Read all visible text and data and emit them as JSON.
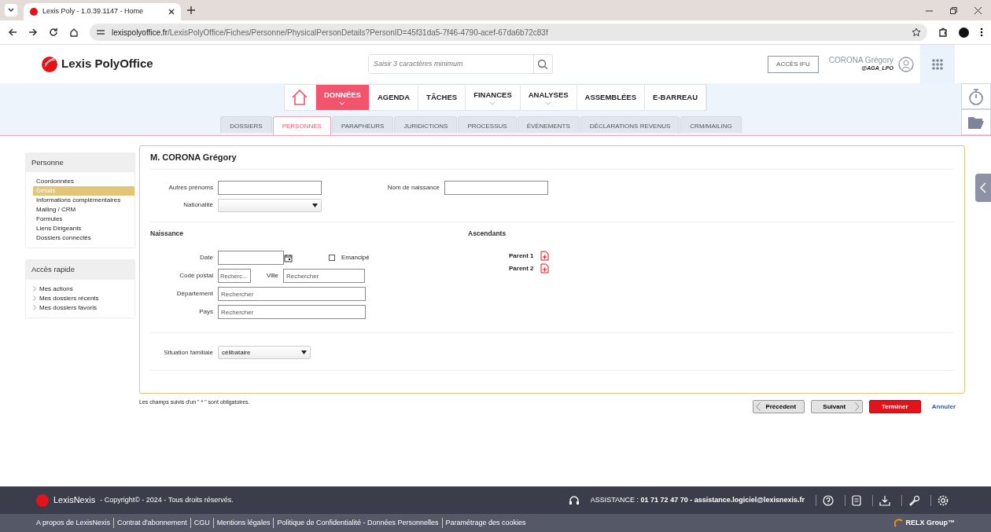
{
  "browser": {
    "tab_title": "Lexis Poly - 1.0.39.1147 - Home",
    "url_domain": "lexispolyoffice.fr",
    "url_path": "/LexisPolyOffice/Fiches/Personne/PhysicalPersonDetails?PersonID=45f31da5-7f46-4790-acef-67da6b72c83f"
  },
  "header": {
    "logo_text": "Lexis PolyOffice",
    "search_placeholder": "Saisir 3 caractères minimum",
    "ifu_button": "ACCÈS IFU",
    "user_name": "CORONA Grégory",
    "user_handle": "@AGA_LPO"
  },
  "main_menu": [
    {
      "label": "DONNÉES",
      "selected": true,
      "dropdown": true
    },
    {
      "label": "AGENDA",
      "selected": false,
      "dropdown": false
    },
    {
      "label": "TÂCHES",
      "selected": false,
      "dropdown": false
    },
    {
      "label": "FINANCES",
      "selected": false,
      "dropdown": true
    },
    {
      "label": "ANALYSES",
      "selected": false,
      "dropdown": true
    },
    {
      "label": "ASSEMBLÉES",
      "selected": false,
      "dropdown": false
    },
    {
      "label": "E-BARREAU",
      "selected": false,
      "dropdown": false
    }
  ],
  "sub_tabs": [
    {
      "label": "DOSSIERS",
      "selected": false
    },
    {
      "label": "PERSONNES",
      "selected": true
    },
    {
      "label": "PARAPHEURS",
      "selected": false
    },
    {
      "label": "JURIDICTIONS",
      "selected": false
    },
    {
      "label": "PROCESSUS",
      "selected": false
    },
    {
      "label": "ÉVÈNEMENTS",
      "selected": false
    },
    {
      "label": "DÉCLARATIONS REVENUS",
      "selected": false
    },
    {
      "label": "CRM/MAILING",
      "selected": false
    }
  ],
  "sidebar": [
    {
      "title": "Personne",
      "kind": "plain",
      "items": [
        {
          "label": "Coordonnées",
          "selected": false
        },
        {
          "label": "Détails",
          "selected": true
        },
        {
          "label": "Informations complémentaires",
          "selected": false
        },
        {
          "label": "Mailing / CRM",
          "selected": false
        },
        {
          "label": "Formules",
          "selected": false
        },
        {
          "label": "Liens Dirigeants",
          "selected": false
        },
        {
          "label": "Dossiers connectés",
          "selected": false
        }
      ]
    },
    {
      "title": "Accès rapide",
      "kind": "arrow",
      "items": [
        {
          "label": "Mes actions",
          "selected": false
        },
        {
          "label": "Mes dossiers récents",
          "selected": false
        },
        {
          "label": "Mes dossiers favoris",
          "selected": false
        }
      ]
    }
  ],
  "form": {
    "title": "M. CORONA Grégory",
    "autres_prenoms": {
      "label": "Autres prénoms"
    },
    "nom_naissance": {
      "label": "Nom de naissance"
    },
    "nationalite": {
      "label": "Nationalité"
    },
    "naissance": {
      "heading": "Naissance",
      "date": {
        "label": "Date"
      },
      "emancipe": {
        "label": "Emancipé",
        "checked": false
      },
      "code_postal": {
        "label": "Code postal",
        "placeholder": "Recherc..."
      },
      "ville": {
        "label": "Ville",
        "placeholder": "Rechercher"
      },
      "departement": {
        "label": "Département",
        "placeholder": "Rechercher"
      },
      "pays": {
        "label": "Pays",
        "placeholder": "Rechercher"
      }
    },
    "ascendants": {
      "heading": "Ascendants",
      "parents": [
        {
          "label": "Parent 1"
        },
        {
          "label": "Parent 2"
        }
      ]
    },
    "situation": {
      "label": "Situation familiale",
      "value": "célibataire"
    }
  },
  "note": "Les champs suivis d'un \" * \" sont obligatoires.",
  "actions": {
    "previous": "Précédent",
    "next": "Suivant",
    "finish": "Terminer",
    "cancel": "Annuler"
  },
  "footer": {
    "brand": "LexisNexis",
    "copyright": "- Copyright© - 2024 - Tous droits réservés.",
    "assistance_label": "ASSISTANCE :",
    "assistance_contact": "01 71 72 47 70 - assistance.logiciel@lexisnexis.fr",
    "links": [
      "A propos de LexisNexis",
      "Contrat d'abonnement",
      "CGU",
      "Mentions légales",
      "Politique de Confidentialité - Données Personnelles",
      "Paramétrage des cookies"
    ],
    "group": "RELX Group™"
  }
}
